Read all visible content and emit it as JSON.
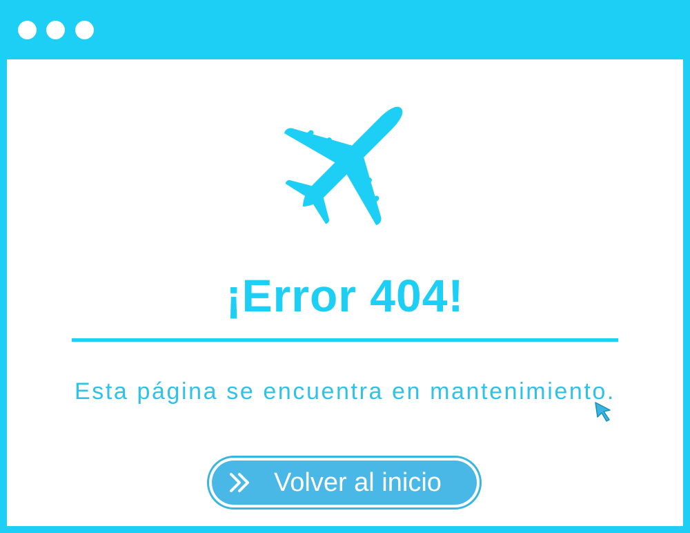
{
  "window": {
    "accent_color": "#1ecff5",
    "controls": [
      "window-dot",
      "window-dot",
      "window-dot"
    ]
  },
  "illustration": {
    "icon": "airplane-icon"
  },
  "error": {
    "title": "¡Error 404!",
    "message": "Esta página se encuentra en mantenimiento."
  },
  "cursor": {
    "icon": "pointer-cursor-icon"
  },
  "actions": {
    "home_button_label": "Volver al inicio",
    "home_button_icon": "double-chevron-right-icon",
    "button_color": "#4ab8e6"
  }
}
